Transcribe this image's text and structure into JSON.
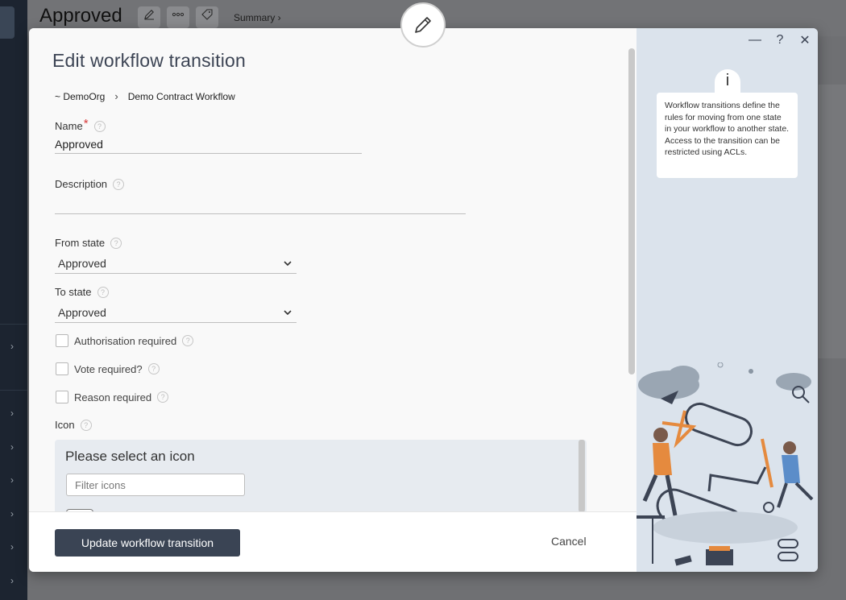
{
  "background": {
    "page_title": "Approved",
    "breadcrumb": "Summary ›",
    "tools": [
      "pencil-icon",
      "more-icon",
      "tag-icon"
    ]
  },
  "modal": {
    "title": "Edit workflow transition",
    "breadcrumb": {
      "org": "~ DemoOrg",
      "workflow": "Demo Contract Workflow"
    },
    "window_controls": {
      "minimize": "—",
      "help": "?",
      "close": "✕"
    },
    "fields": {
      "name": {
        "label": "Name",
        "value": "Approved"
      },
      "description": {
        "label": "Description",
        "value": ""
      },
      "from_state": {
        "label": "From state",
        "selected": "Approved"
      },
      "to_state": {
        "label": "To state",
        "selected": "Approved"
      }
    },
    "checkboxes": [
      {
        "label": "Authorisation required",
        "checked": false
      },
      {
        "label": "Vote required?",
        "checked": false
      },
      {
        "label": "Reason required",
        "checked": false
      }
    ],
    "icon": {
      "label": "Icon",
      "panel_title": "Please select an icon",
      "filter_placeholder": "Filter icons"
    },
    "footer": {
      "primary_button": "Update workflow transition",
      "cancel_button": "Cancel"
    },
    "help_panel": {
      "text": "Workflow transitions define the rules for moving from one state in your workflow to another state. Access to the transition can be restricted using ACLs."
    }
  },
  "colors": {
    "primary_button": "#3a4454",
    "side_panel": "#dbe3ec",
    "required": "#d83a3a",
    "title": "#3c4454"
  }
}
